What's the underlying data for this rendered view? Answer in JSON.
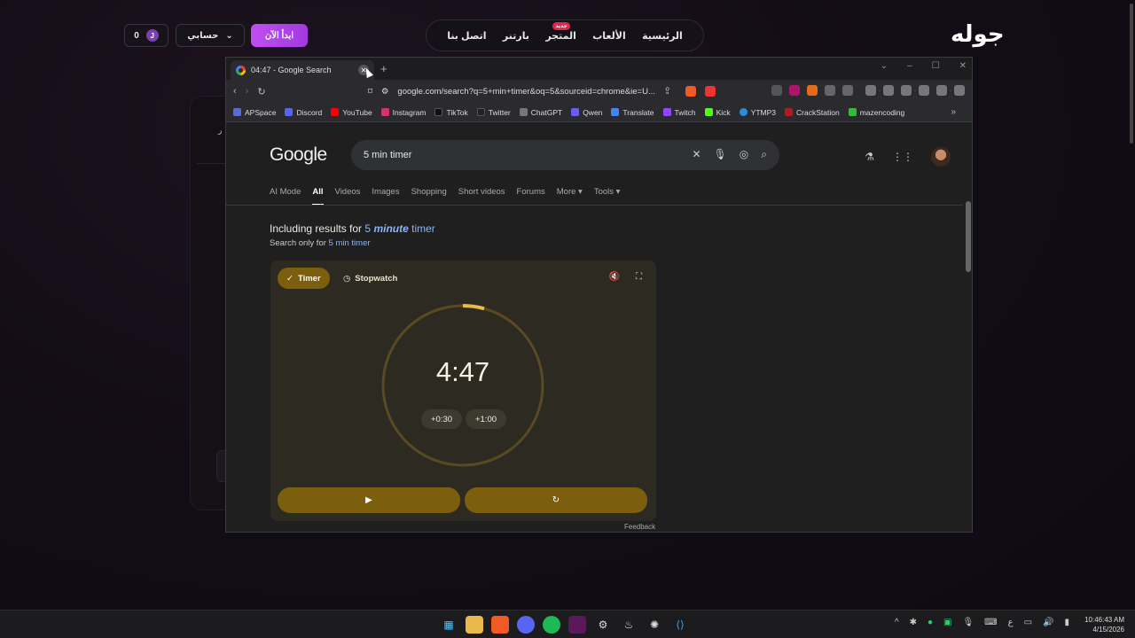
{
  "site": {
    "logo": "جوله",
    "nav": [
      "الرئيسية",
      "الألعاب",
      "المتجر",
      "بارتنر",
      "اتصل بنا"
    ],
    "nav_badge": "جديد",
    "start_button": "ابدأ الآن",
    "account_button": "حسابي",
    "coins": "0",
    "coin_symbol": "J",
    "card_label": "ر"
  },
  "browser": {
    "tab_title": "04:47 - Google Search",
    "url": "google.com/search?q=5+min+timer&oq=5&sourceid=chrome&ie=U...",
    "bookmarks": [
      {
        "label": "APSpace",
        "color": "#5b6bd6"
      },
      {
        "label": "Discord",
        "color": "#5865f2"
      },
      {
        "label": "YouTube",
        "color": "#ff0000"
      },
      {
        "label": "Instagram",
        "color": "#d6336c"
      },
      {
        "label": "TikTok",
        "color": "#111111"
      },
      {
        "label": "Twitter",
        "color": "#222222"
      },
      {
        "label": "ChatGPT",
        "color": "#777777"
      },
      {
        "label": "Qwen",
        "color": "#6b5cf0"
      },
      {
        "label": "Translate",
        "color": "#4285f4"
      },
      {
        "label": "Twitch",
        "color": "#9146ff"
      },
      {
        "label": "Kick",
        "color": "#53fc18"
      },
      {
        "label": "YTMP3",
        "color": "#2b8fd6"
      },
      {
        "label": "CrackStation",
        "color": "#b01c1c"
      },
      {
        "label": "mazencoding",
        "color": "#2fbf3a"
      }
    ]
  },
  "google": {
    "logo": "Google",
    "query": "5 min timer",
    "tabs": [
      "AI Mode",
      "All",
      "Videos",
      "Images",
      "Shopping",
      "Short videos",
      "Forums",
      "More ▾",
      "Tools ▾"
    ],
    "including_prefix": "Including results for",
    "including_num": "5",
    "including_word": "minute",
    "including_suffix": "timer",
    "search_only_prefix": "Search only for",
    "search_only_link": "5 min timer",
    "timer_chip": "Timer",
    "stopwatch_chip": "Stopwatch",
    "time": "4:47",
    "add_30": "+0:30",
    "add_100": "+1:00",
    "feedback": "Feedback",
    "progress_fraction": 0.957
  },
  "taskbar": {
    "time": "10:46:43 AM",
    "date": "4/15/2026",
    "lang": "ع"
  }
}
